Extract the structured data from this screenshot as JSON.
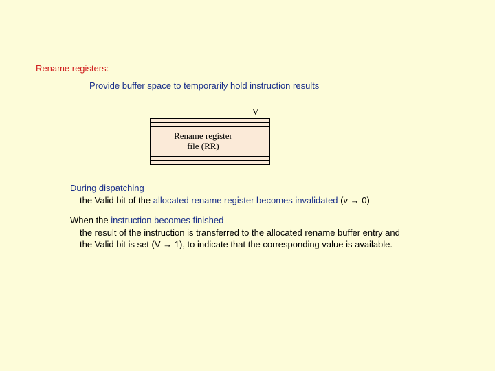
{
  "heading": "Rename registers:",
  "subtitle": "Provide buffer space to temporarily hold instruction results",
  "diagram": {
    "v_label": "V",
    "box_line1": "Rename register",
    "box_line2": "file (RR)"
  },
  "para1": {
    "lead_blue": "During dispatching",
    "line2_a": "the Valid bit of the ",
    "line2_blue": "allocated rename register becomes invalidated",
    "line2_b": " (v ",
    "arrow": "→",
    "line2_c": " 0)"
  },
  "para2": {
    "lead_a": "When the ",
    "lead_blue": "instruction becomes finished",
    "line2": "the result of the instruction is transferred to the allocated rename buffer entry  and",
    "line3_a": "the Valid bit is set (V ",
    "arrow": "→",
    "line3_b": " 1), to indicate that the corresponding value is available."
  }
}
